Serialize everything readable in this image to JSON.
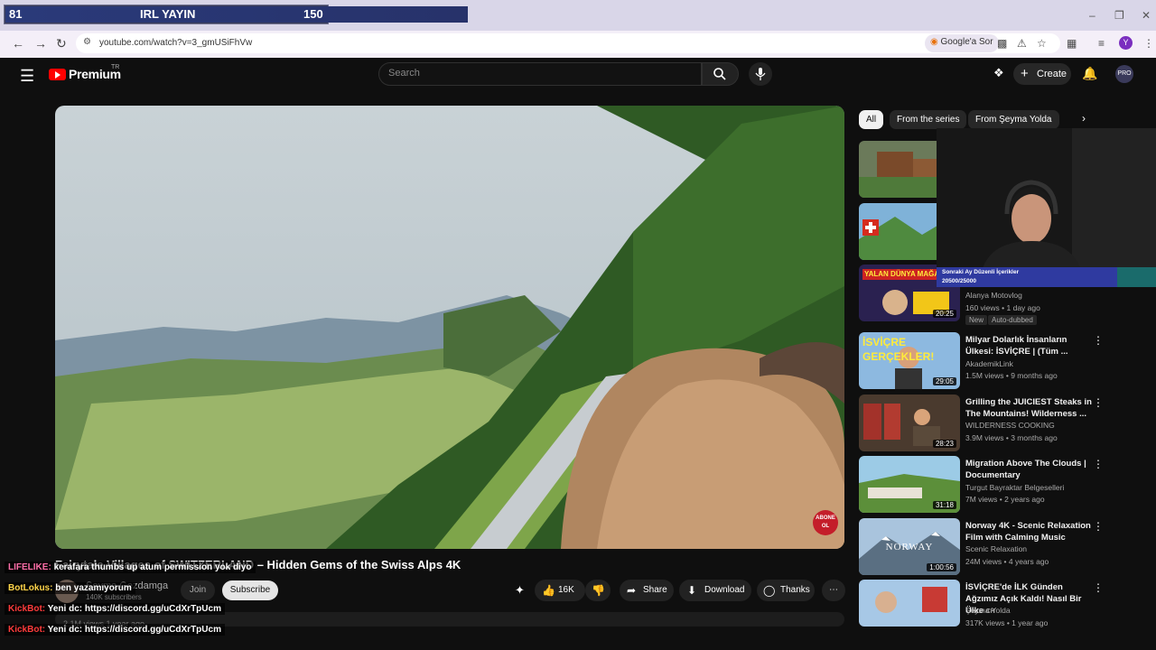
{
  "overlay": {
    "left_value": "81",
    "title": "IRL YAYIN",
    "right_value": "150"
  },
  "browser": {
    "url": "youtube.com/watch?v=3_gmUSiFhVw",
    "google_sor": "Google'a Sor",
    "profile_letter": "Y"
  },
  "header": {
    "brand": "Premium",
    "region": "TR",
    "search_placeholder": "Search",
    "create_label": "Create",
    "avatar_label": "PRO"
  },
  "video": {
    "title": "Fairytale Villages of SWITZERLAND – Hidden Gems of the Swiss Alps 4K",
    "channel": "Şeyma Gezdamga",
    "subscribers": "140K subscribers",
    "join_label": "Join",
    "subscribe_label": "Subscribe",
    "likes": "16K",
    "share_label": "Share",
    "download_label": "Download",
    "thanks_label": "Thanks",
    "views_line": "2.1M views  1 year ago",
    "watermark": "ABONE OL"
  },
  "chat": [
    {
      "name": "LIFELIKE:",
      "text": "kerafara thumbs up atum permission yok diyo"
    },
    {
      "name": "BotLokus:",
      "text": "ben yazamıyorum"
    },
    {
      "name": "KickBot:",
      "text": "Yeni dc: https://discord.gg/uCdXrTpUcm"
    },
    {
      "name": "KickBot:",
      "text": "Yeni dc: https://discord.gg/uCdXrTpUcm"
    }
  ],
  "filters": [
    "All",
    "From the series",
    "From Şeyma Yolda"
  ],
  "sub_goal": {
    "title": "Sonraki Ay Düzenli İçerikler",
    "count": "20500/25000"
  },
  "sidebar": [
    {
      "title": "",
      "channel": "",
      "meta": "",
      "duration": ""
    },
    {
      "title": "",
      "channel": "",
      "meta": "",
      "duration": ""
    },
    {
      "title": "",
      "channel": "Alanya Motovlog",
      "meta": "160 views • 1 day ago",
      "duration": "20:25",
      "badge_new": "New",
      "badge_dub": "Auto-dubbed",
      "thumb_text": "YALAN DÜNYA MAĞAR"
    },
    {
      "title": "Milyar Dolarlık İnsanların Ülkesi: İSVİÇRE | (Tüm ...",
      "channel": "AkademikLink",
      "meta": "1.5M views • 9 months ago",
      "duration": "29:05",
      "thumb_text": "İSVİÇRE GERÇEKLER!"
    },
    {
      "title": "Grilling the JUICIEST Steaks in The Mountains! Wilderness ...",
      "channel": "WILDERNESS COOKING",
      "meta": "3.9M views • 3 months ago",
      "duration": "28:23"
    },
    {
      "title": "Migration Above The Clouds | Documentary",
      "channel": "Turgut Bayraktar Belgeselleri",
      "meta": "7M views • 2 years ago",
      "duration": "31:18"
    },
    {
      "title": "Norway 4K - Scenic Relaxation Film with Calming Music",
      "channel": "Scenic Relaxation",
      "meta": "24M views • 4 years ago",
      "duration": "1:00:56",
      "thumb_text": "NORWAY"
    },
    {
      "title": "İSVİÇRE'de İLK Günden Ağzımız Açık Kaldı! Nasıl Bir Ülke",
      "channel": "Şeyma Yolda",
      "meta": "317K views • 1 year ago",
      "duration": "",
      "title_suffix": "CH"
    }
  ]
}
